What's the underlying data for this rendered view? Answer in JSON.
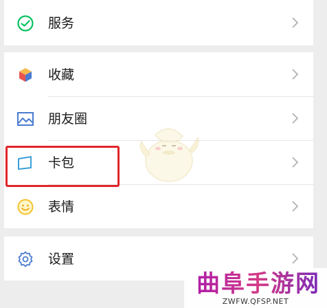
{
  "menu": {
    "items": [
      {
        "label": "服务",
        "icon": "service-icon"
      },
      {
        "label": "收藏",
        "icon": "favorites-icon"
      },
      {
        "label": "朋友圈",
        "icon": "moments-icon"
      },
      {
        "label": "卡包",
        "icon": "card-wallet-icon"
      },
      {
        "label": "表情",
        "icon": "sticker-icon"
      },
      {
        "label": "设置",
        "icon": "settings-icon"
      }
    ]
  },
  "colors": {
    "background": "#ededed",
    "row_background": "#ffffff",
    "highlight": "#e0262a",
    "accent_green": "#07c160",
    "accent_blue": "#4a7bd0"
  },
  "watermark": {
    "title": "曲阜手游网",
    "url": "ZWFW.QFSP.NET"
  }
}
